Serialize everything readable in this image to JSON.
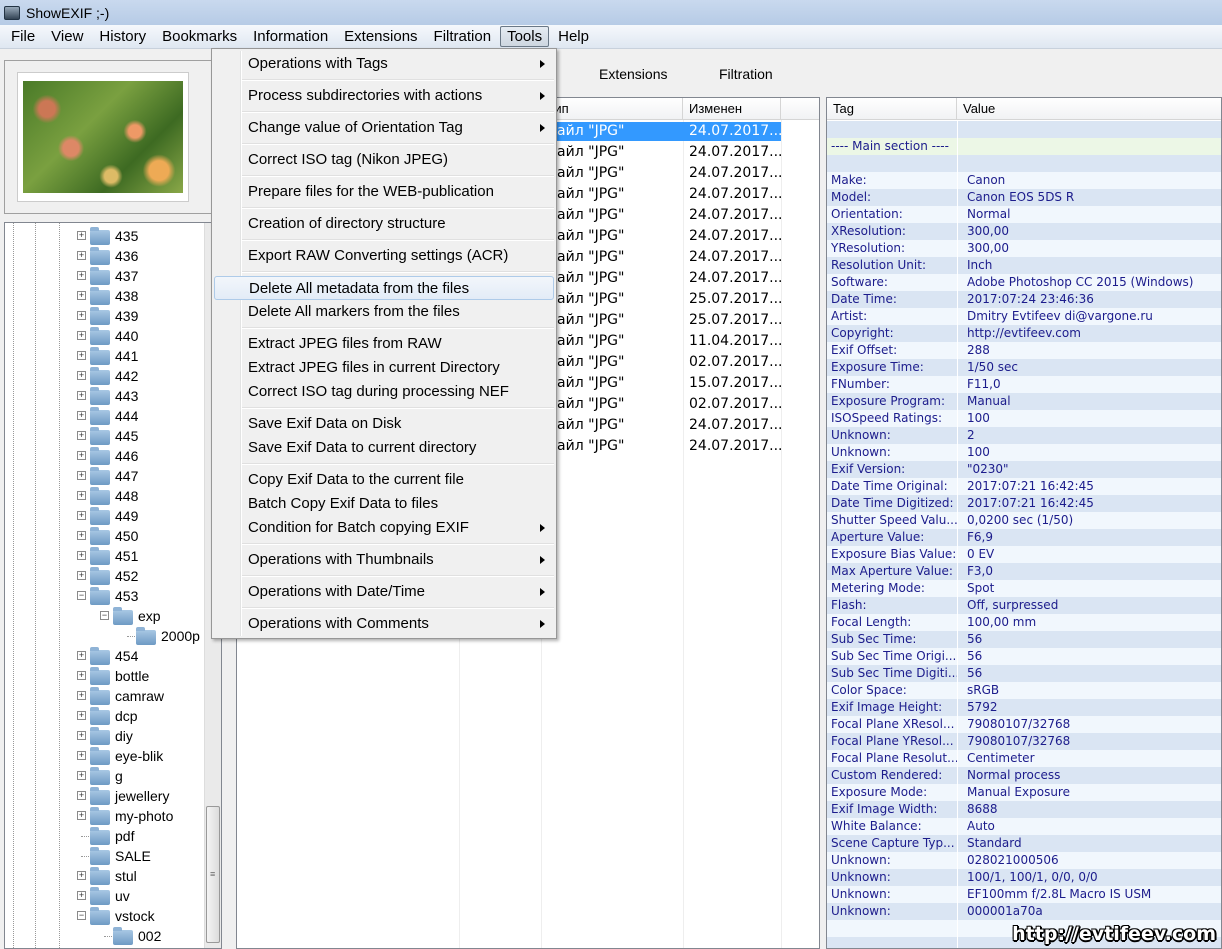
{
  "window": {
    "title": "ShowEXIF ;-)"
  },
  "menubar": [
    {
      "label": "File"
    },
    {
      "label": "View"
    },
    {
      "label": "History"
    },
    {
      "label": "Bookmarks"
    },
    {
      "label": "Information"
    },
    {
      "label": "Extensions"
    },
    {
      "label": "Filtration"
    },
    {
      "label": "Tools",
      "active": true
    },
    {
      "label": "Help"
    }
  ],
  "tabs": [
    {
      "label": "Extensions"
    },
    {
      "label": "Filtration"
    }
  ],
  "tree": {
    "items": [
      {
        "label": "435",
        "level": 0,
        "box": "+"
      },
      {
        "label": "436",
        "level": 0,
        "box": "+"
      },
      {
        "label": "437",
        "level": 0,
        "box": "+"
      },
      {
        "label": "438",
        "level": 0,
        "box": "+"
      },
      {
        "label": "439",
        "level": 0,
        "box": "+"
      },
      {
        "label": "440",
        "level": 0,
        "box": "+"
      },
      {
        "label": "441",
        "level": 0,
        "box": "+"
      },
      {
        "label": "442",
        "level": 0,
        "box": "+"
      },
      {
        "label": "443",
        "level": 0,
        "box": "+"
      },
      {
        "label": "444",
        "level": 0,
        "box": "+"
      },
      {
        "label": "445",
        "level": 0,
        "box": "+"
      },
      {
        "label": "446",
        "level": 0,
        "box": "+"
      },
      {
        "label": "447",
        "level": 0,
        "box": "+"
      },
      {
        "label": "448",
        "level": 0,
        "box": "+"
      },
      {
        "label": "449",
        "level": 0,
        "box": "+"
      },
      {
        "label": "450",
        "level": 0,
        "box": "+"
      },
      {
        "label": "451",
        "level": 0,
        "box": "+"
      },
      {
        "label": "452",
        "level": 0,
        "box": "+"
      },
      {
        "label": "453",
        "level": 0,
        "box": "-"
      },
      {
        "label": "exp",
        "level": 1,
        "box": "-"
      },
      {
        "label": "2000p",
        "level": 2,
        "box": ""
      },
      {
        "label": "454",
        "level": 0,
        "box": "+"
      },
      {
        "label": "bottle",
        "level": 0,
        "box": "+"
      },
      {
        "label": "camraw",
        "level": 0,
        "box": "+"
      },
      {
        "label": "dcp",
        "level": 0,
        "box": "+"
      },
      {
        "label": "diy",
        "level": 0,
        "box": "+"
      },
      {
        "label": "eye-blik",
        "level": 0,
        "box": "+"
      },
      {
        "label": "g",
        "level": 0,
        "box": "+"
      },
      {
        "label": "jewellery",
        "level": 0,
        "box": "+"
      },
      {
        "label": "my-photo",
        "level": 0,
        "box": "+"
      },
      {
        "label": "pdf",
        "level": 0,
        "box": ""
      },
      {
        "label": "SALE",
        "level": 0,
        "box": ""
      },
      {
        "label": "stul",
        "level": 0,
        "box": "+"
      },
      {
        "label": "uv",
        "level": 0,
        "box": "+"
      },
      {
        "label": "vstock",
        "level": 0,
        "box": "-"
      },
      {
        "label": "002",
        "level": 1,
        "box": ""
      }
    ]
  },
  "filelist": {
    "headers": {
      "type": "Тип",
      "modified": "Изменен"
    },
    "rows": [
      {
        "type": "Файл \"JPG\"",
        "modified": "24.07.2017...",
        "selected": true
      },
      {
        "type": "Файл \"JPG\"",
        "modified": "24.07.2017..."
      },
      {
        "type": "Файл \"JPG\"",
        "modified": "24.07.2017..."
      },
      {
        "type": "Файл \"JPG\"",
        "modified": "24.07.2017..."
      },
      {
        "type": "Файл \"JPG\"",
        "modified": "24.07.2017..."
      },
      {
        "type": "Файл \"JPG\"",
        "modified": "24.07.2017..."
      },
      {
        "type": "Файл \"JPG\"",
        "modified": "24.07.2017..."
      },
      {
        "type": "Файл \"JPG\"",
        "modified": "24.07.2017..."
      },
      {
        "type": "Файл \"JPG\"",
        "modified": "25.07.2017..."
      },
      {
        "type": "Файл \"JPG\"",
        "modified": "25.07.2017..."
      },
      {
        "type": "Файл \"JPG\"",
        "modified": "11.04.2017..."
      },
      {
        "type": "Файл \"JPG\"",
        "modified": "02.07.2017..."
      },
      {
        "type": "Файл \"JPG\"",
        "modified": "15.07.2017..."
      },
      {
        "type": "Файл \"JPG\"",
        "modified": "02.07.2017..."
      },
      {
        "type": "Файл \"JPG\"",
        "modified": "24.07.2017..."
      },
      {
        "type": "Файл \"JPG\"",
        "modified": "24.07.2017..."
      }
    ]
  },
  "exif": {
    "headers": {
      "tag": "Tag",
      "value": "Value"
    },
    "rows": [
      {
        "tag": "",
        "value": ""
      },
      {
        "tag": "---- Main section ----",
        "value": "",
        "section": true
      },
      {
        "tag": "",
        "value": ""
      },
      {
        "tag": "Make:",
        "value": "Canon"
      },
      {
        "tag": "Model:",
        "value": "Canon EOS 5DS R"
      },
      {
        "tag": "Orientation:",
        "value": "Normal"
      },
      {
        "tag": "XResolution:",
        "value": "300,00"
      },
      {
        "tag": "YResolution:",
        "value": "300,00"
      },
      {
        "tag": "Resolution Unit:",
        "value": "Inch"
      },
      {
        "tag": "Software:",
        "value": "Adobe Photoshop CC 2015 (Windows)"
      },
      {
        "tag": "Date Time:",
        "value": "2017:07:24 23:46:36"
      },
      {
        "tag": "Artist:",
        "value": "Dmitry Evtifeev di@vargone.ru"
      },
      {
        "tag": "Copyright:",
        "value": "http://evtifeev.com"
      },
      {
        "tag": "Exif Offset:",
        "value": "288"
      },
      {
        "tag": "Exposure Time:",
        "value": "1/50 sec"
      },
      {
        "tag": "FNumber:",
        "value": "F11,0"
      },
      {
        "tag": "Exposure Program:",
        "value": "Manual"
      },
      {
        "tag": "ISOSpeed Ratings:",
        "value": "100"
      },
      {
        "tag": "Unknown:",
        "value": "2"
      },
      {
        "tag": "Unknown:",
        "value": "100"
      },
      {
        "tag": "Exif Version:",
        "value": "\"0230\""
      },
      {
        "tag": "Date Time Original:",
        "value": "2017:07:21 16:42:45"
      },
      {
        "tag": "Date Time Digitized:",
        "value": "2017:07:21 16:42:45"
      },
      {
        "tag": "Shutter Speed Valu...",
        "value": "0,0200 sec (1/50)"
      },
      {
        "tag": "Aperture Value:",
        "value": "F6,9"
      },
      {
        "tag": "Exposure Bias Value:",
        "value": "0 EV"
      },
      {
        "tag": "Max Aperture Value:",
        "value": "F3,0"
      },
      {
        "tag": "Metering Mode:",
        "value": "Spot"
      },
      {
        "tag": "Flash:",
        "value": "Off, surpressed"
      },
      {
        "tag": "Focal Length:",
        "value": "100,00 mm"
      },
      {
        "tag": "Sub Sec Time:",
        "value": "56"
      },
      {
        "tag": "Sub Sec Time Origi...",
        "value": "56"
      },
      {
        "tag": "Sub Sec Time Digiti...",
        "value": "56"
      },
      {
        "tag": "Color Space:",
        "value": "sRGB"
      },
      {
        "tag": "Exif Image Height:",
        "value": "5792"
      },
      {
        "tag": "Focal Plane XResol...",
        "value": "79080107/32768"
      },
      {
        "tag": "Focal Plane YResol...",
        "value": "79080107/32768"
      },
      {
        "tag": "Focal Plane Resolut...",
        "value": "Centimeter"
      },
      {
        "tag": "Custom Rendered:",
        "value": "Normal process"
      },
      {
        "tag": "Exposure Mode:",
        "value": "Manual Exposure"
      },
      {
        "tag": "Exif Image Width:",
        "value": "8688"
      },
      {
        "tag": "White Balance:",
        "value": "Auto"
      },
      {
        "tag": "Scene Capture Typ...",
        "value": "Standard"
      },
      {
        "tag": "Unknown:",
        "value": "028021000506"
      },
      {
        "tag": "Unknown:",
        "value": "100/1, 100/1, 0/0, 0/0"
      },
      {
        "tag": "Unknown:",
        "value": "EF100mm f/2.8L Macro IS USM"
      },
      {
        "tag": "Unknown:",
        "value": "000001a70a"
      },
      {
        "tag": "",
        "value": ""
      },
      {
        "tag": "",
        "value": ""
      }
    ]
  },
  "tools_menu": {
    "groups": [
      [
        {
          "label": "Operations with Tags",
          "submenu": true
        }
      ],
      [
        {
          "label": "Process subdirectories with actions",
          "submenu": true
        }
      ],
      [
        {
          "label": "Change value of Orientation Tag",
          "submenu": true
        }
      ],
      [
        {
          "label": "Correct ISO tag (Nikon JPEG)"
        }
      ],
      [
        {
          "label": "Prepare files for the WEB-publication"
        }
      ],
      [
        {
          "label": "Creation of directory structure"
        }
      ],
      [
        {
          "label": "Export RAW Converting settings (ACR)"
        }
      ],
      [
        {
          "label": "Delete All metadata from the files",
          "highlighted": true
        },
        {
          "label": "Delete All markers from the files"
        }
      ],
      [
        {
          "label": "Extract JPEG files from RAW"
        },
        {
          "label": "Extract JPEG files in current Directory"
        },
        {
          "label": "Correct ISO tag during processing NEF"
        }
      ],
      [
        {
          "label": "Save Exif Data on Disk"
        },
        {
          "label": "Save Exif Data to current directory"
        }
      ],
      [
        {
          "label": "Copy Exif Data to the current file"
        },
        {
          "label": "Batch Copy Exif Data to files"
        },
        {
          "label": "Condition for Batch copying EXIF",
          "submenu": true
        }
      ],
      [
        {
          "label": "Operations with Thumbnails",
          "submenu": true
        }
      ],
      [
        {
          "label": "Operations with Date/Time",
          "submenu": true
        }
      ],
      [
        {
          "label": "Operations with Comments",
          "submenu": true
        }
      ]
    ]
  },
  "watermark": "http://evtifeev.com",
  "colors": {
    "selection": "#3399ff",
    "exif_text": "#1c1c8c",
    "exif_row_a": "#dae5f3",
    "exif_row_b": "#f1f7fd",
    "section_row": "#ecf7e6"
  }
}
